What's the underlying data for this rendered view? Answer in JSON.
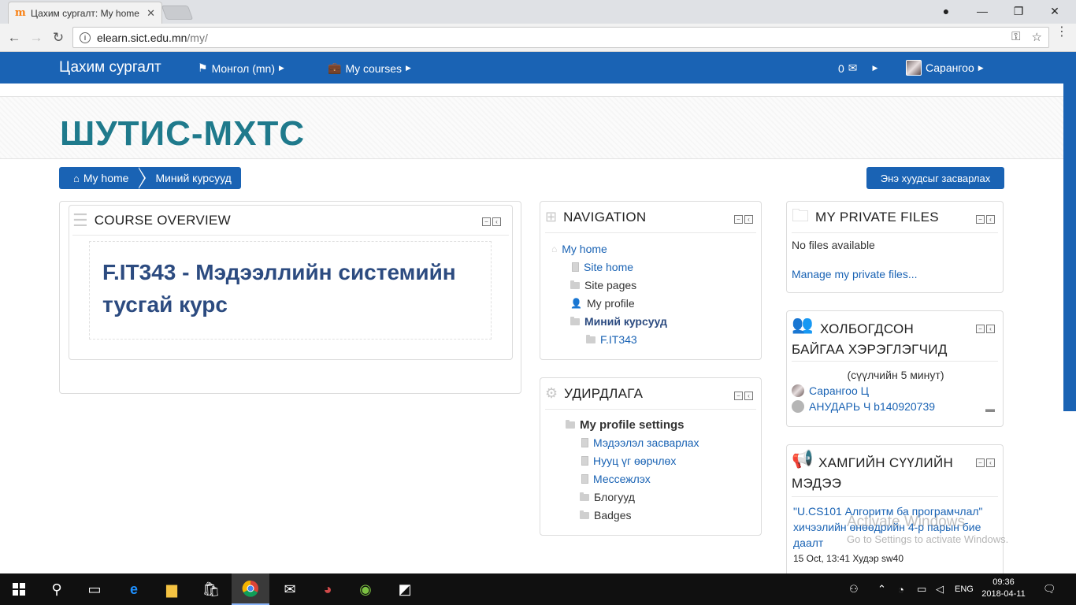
{
  "browser": {
    "tab_title": "Цахим сургалт: My home",
    "tab_close": "✕",
    "url_host": "elearn.sict.edu.mn",
    "url_path": "/my/"
  },
  "moodle_nav": {
    "brand": "Цахим сургалт",
    "language": "Монгол (mn)",
    "my_courses": "My courses",
    "messages_count": "0",
    "user_name": "Сарангоо"
  },
  "header": {
    "site_title": "ШУТИС-МХТС"
  },
  "breadcrumb": {
    "home": "My home",
    "current": "Миний курсууд"
  },
  "edit_button": "Энэ хуудсыг засварлах",
  "course_overview": {
    "title": "COURSE OVERVIEW",
    "course_name": "F.IT343 - Мэдээллийн системийн тусгай курс"
  },
  "navigation": {
    "title": "NAVIGATION",
    "items": [
      "My home",
      "Site home",
      "Site pages",
      "My profile",
      "Миний курсууд",
      "F.IT343"
    ]
  },
  "admin": {
    "title": "УДИРДЛАГА",
    "section": "My profile settings",
    "items": [
      "Мэдээлэл засварлах",
      "Нууц үг өөрчлөх",
      "Мессежлэх",
      "Блогууд",
      "Badges"
    ]
  },
  "private_files": {
    "title": "MY PRIVATE FILES",
    "empty": "No files available",
    "manage": "Manage my private files..."
  },
  "online_users": {
    "title_line1": "ХОЛБОГДСОН",
    "title_line2": "БАЙГАА ХЭРЭГЛЭГЧИД",
    "period": "(сүүлчийн 5 минут)",
    "users": [
      "Сарангоо Ц",
      "АНУДАРЬ Ч b140920739"
    ]
  },
  "news": {
    "title_line1": "ХАМГИЙН СҮҮЛИЙН",
    "title_line2": "МЭДЭЭ",
    "item_text": "\"U.CS101 Алгоритм ба програмчлал\" хичээлийн өнөөдрийн 4-р парын бие даалт",
    "item_meta": "15 Oct, 13:41 Худэр sw40"
  },
  "watermark": {
    "line1": "Activate Windows",
    "line2": "Go to Settings to activate Windows."
  },
  "taskbar": {
    "language": "ENG",
    "time": "09:36",
    "date": "2018-04-11"
  },
  "colors": {
    "moodle_blue": "#1a63b4",
    "title_teal": "#1f7a8c",
    "course_link": "#2c4b80"
  }
}
